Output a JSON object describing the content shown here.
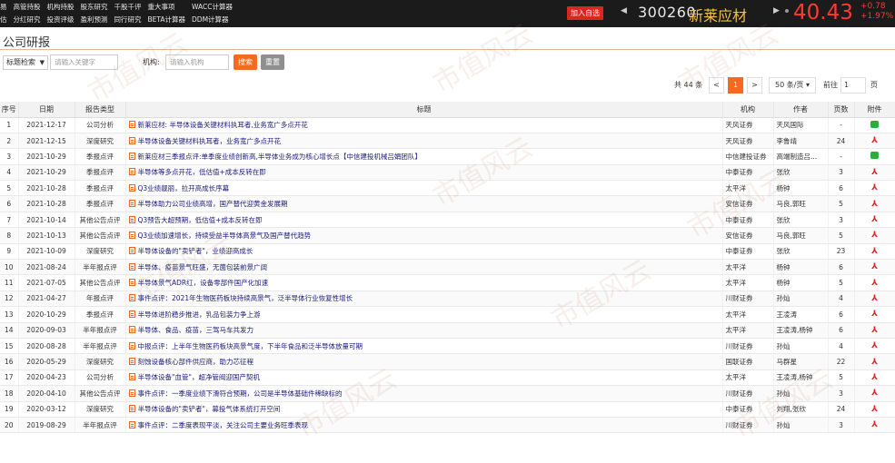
{
  "topnav": [
    [
      "易",
      "高管持股",
      "机构持股",
      "股东研究",
      "千股千评",
      "重大事项",
      "WACC计算器"
    ],
    [
      "估",
      "分红研究",
      "投资评级",
      "盈利预测",
      "同行研究",
      "BETA计算器",
      "DDM计算器"
    ]
  ],
  "stock": {
    "add_label": "加入自选",
    "code": "300260",
    "name": "新莱应材",
    "price": "40.43",
    "change": "+0.78",
    "change_pct": "+1.97%",
    "prev_arrow": "◀",
    "next_arrow": "▶"
  },
  "page_title": "公司研报",
  "search": {
    "type_select": "标题检索",
    "keyword_placeholder": "请输入关键字",
    "org_label": "机构:",
    "org_placeholder": "请输入机构",
    "search_btn": "搜索",
    "reset_btn": "重置"
  },
  "pager": {
    "total": "共 44 条",
    "prev": "<",
    "current": "1",
    "next": ">",
    "page_size": "50 条/页",
    "goto_label": "前往",
    "goto_value": "1",
    "page_unit": "页"
  },
  "table": {
    "headers": [
      "序号",
      "日期",
      "报告类型",
      "标题",
      "机构",
      "作者",
      "页数",
      "附件"
    ],
    "rows": [
      [
        "1",
        "2021-12-17",
        "公司分析",
        "新莱应材: 半导体设备关键材料执耳者,业务宽广多点开花",
        "天风证券",
        "天风国际",
        "-",
        "wc"
      ],
      [
        "2",
        "2021-12-15",
        "深度研究",
        "半导体设备关键材料执耳者，业务宽广多点开花",
        "天风证券",
        "李鲁靖",
        "24",
        "pdf"
      ],
      [
        "3",
        "2021-10-29",
        "季报点评",
        "新莱应材三季报点评:单季度业绩创新高,半导体业务成为核心增长点【中信建投机械吕娟团队】",
        "中信建投证券",
        "高端制造吕...",
        "-",
        "wc"
      ],
      [
        "4",
        "2021-10-29",
        "季报点评",
        "半导体等多点开花，低估值+成本反转在即",
        "中泰证券",
        "张欣",
        "3",
        "pdf"
      ],
      [
        "5",
        "2021-10-28",
        "季报点评",
        "Q3业绩靓丽，拉开高成长序幕",
        "太平洋",
        "杨钟",
        "6",
        "pdf"
      ],
      [
        "6",
        "2021-10-28",
        "季报点评",
        "半导体助力公司业绩高增，国产替代迎黄金发展期",
        "安信证券",
        "马良,郭旺",
        "5",
        "pdf"
      ],
      [
        "7",
        "2021-10-14",
        "其他公告点评",
        "Q3预告大超预期，低估值+成本反转在即",
        "中泰证券",
        "张欣",
        "3",
        "pdf"
      ],
      [
        "8",
        "2021-10-13",
        "其他公告点评",
        "Q3业绩加速增长，持续受益半导体高景气及国产替代趋势",
        "安信证券",
        "马良,郭旺",
        "5",
        "pdf"
      ],
      [
        "9",
        "2021-10-09",
        "深度研究",
        "半导体设备的\"卖铲者\"，业绩迎高成长",
        "中泰证券",
        "张欣",
        "23",
        "pdf"
      ],
      [
        "10",
        "2021-08-24",
        "半年报点评",
        "半导体、疫苗景气旺盛，无菌包装前景广阔",
        "太平洋",
        "杨钟",
        "6",
        "pdf"
      ],
      [
        "11",
        "2021-07-05",
        "其他公告点评",
        "半导体景气ADR红，设备零部件国产化加速",
        "太平洋",
        "杨钟",
        "5",
        "pdf"
      ],
      [
        "12",
        "2021-04-27",
        "年报点评",
        "事件点评：2021年生物医药板块持续高景气，泛半导体行业恢复性增长",
        "川财证券",
        "孙灿",
        "4",
        "pdf"
      ],
      [
        "13",
        "2020-10-29",
        "季报点评",
        "半导体进阶稳步推进，乳品包装力争上游",
        "太平洋",
        "王凌涛",
        "6",
        "pdf"
      ],
      [
        "14",
        "2020-09-03",
        "半年报点评",
        "半导体、食品、疫苗，三驾马车共发力",
        "太平洋",
        "王凌涛,杨钟",
        "6",
        "pdf"
      ],
      [
        "15",
        "2020-08-28",
        "半年报点评",
        "中报点评：上半年生物医药板块高景气度，下半年食品和泛半导体放量可期",
        "川财证券",
        "孙灿",
        "4",
        "pdf"
      ],
      [
        "16",
        "2020-05-29",
        "深度研究",
        "刻蚀设备核心部件供应商，助力芯征程",
        "国联证券",
        "马群星",
        "22",
        "pdf"
      ],
      [
        "17",
        "2020-04-23",
        "公司分析",
        "半导体设备\"血管\"，超净管阀迎国产契机",
        "太平洋",
        "王凌涛,杨钟",
        "5",
        "pdf"
      ],
      [
        "18",
        "2020-04-10",
        "其他公告点评",
        "事件点评：一季度业绩下滑符合预期，公司是半导体基础件稀缺标的",
        "川财证券",
        "孙灿",
        "3",
        "pdf"
      ],
      [
        "19",
        "2020-03-12",
        "深度研究",
        "半导体设备的\"卖铲者\"，募投气体系统打开空间",
        "中泰证券",
        "刘翔,张欣",
        "24",
        "pdf"
      ],
      [
        "20",
        "2019-08-29",
        "半年报点评",
        "事件点评：二季度表现平淡，关注公司主要业务旺季表现",
        "川财证券",
        "孙灿",
        "3",
        "pdf"
      ]
    ]
  },
  "watermark": "市值风云"
}
